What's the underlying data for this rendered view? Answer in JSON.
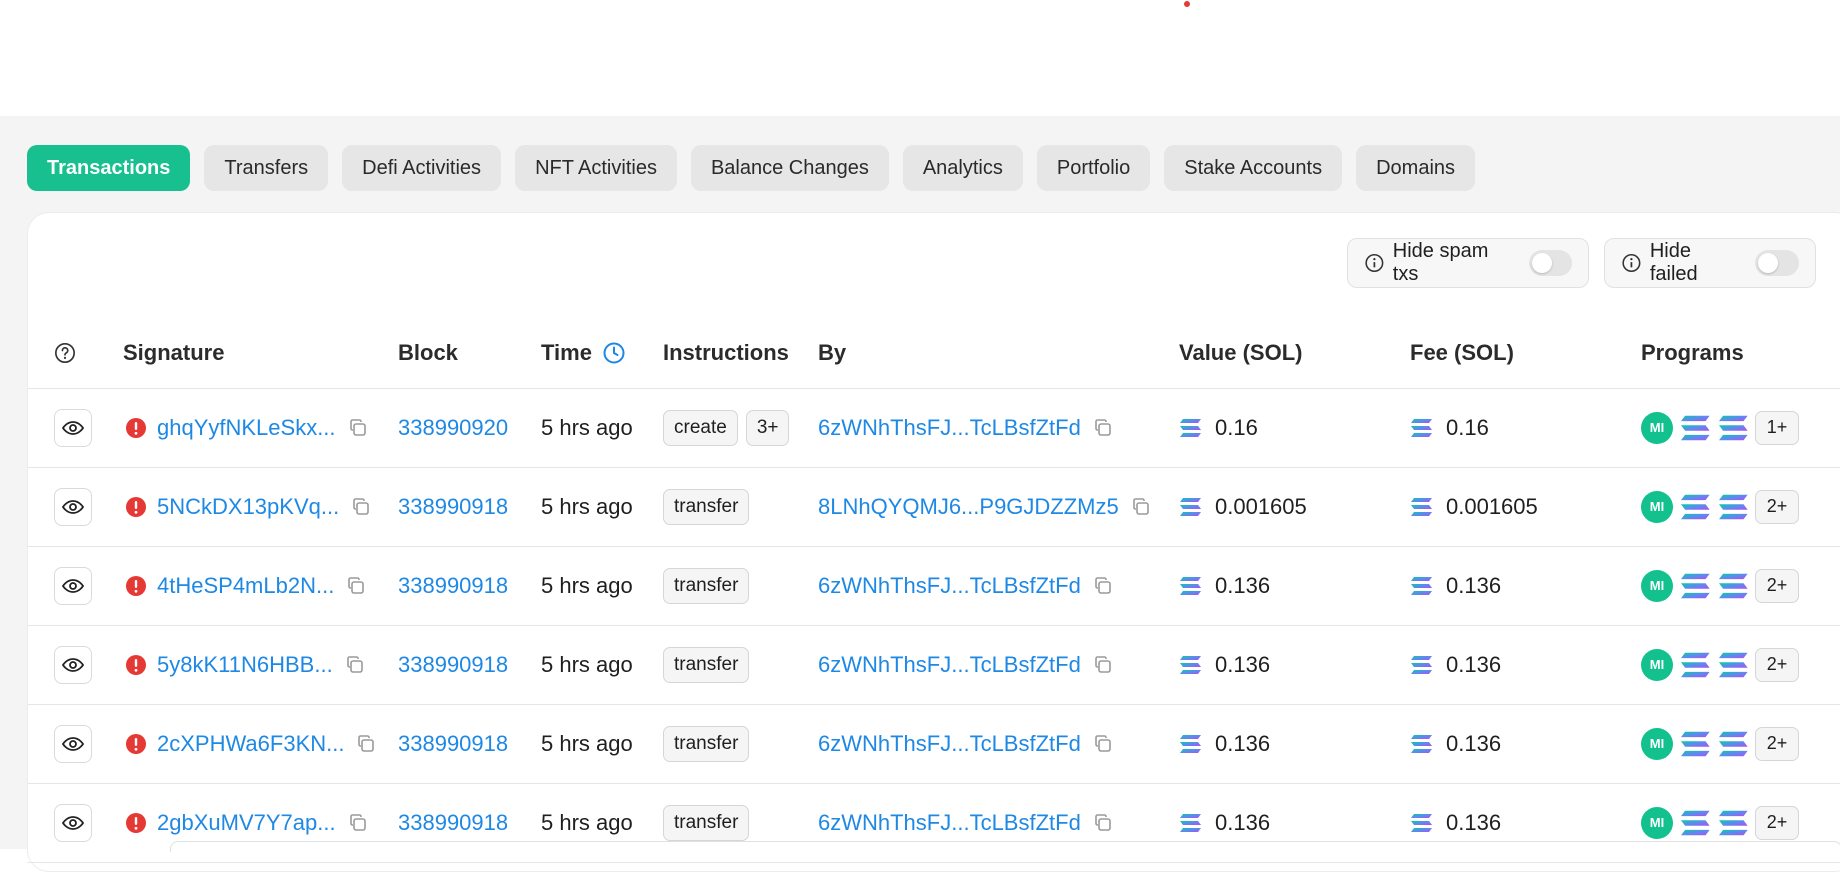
{
  "tabs": [
    "Transactions",
    "Transfers",
    "Defi Activities",
    "NFT Activities",
    "Balance Changes",
    "Analytics",
    "Portfolio",
    "Stake Accounts",
    "Domains"
  ],
  "filters": {
    "hide_spam": "Hide spam txs",
    "hide_failed": "Hide failed"
  },
  "headers": {
    "signature": "Signature",
    "block": "Block",
    "time": "Time",
    "instructions": "Instructions",
    "by": "By",
    "value": "Value (SOL)",
    "fee": "Fee (SOL)",
    "programs": "Programs"
  },
  "rows": [
    {
      "signature": "ghqYyfNKLeSkx...",
      "block": "338990920",
      "time": "5 hrs ago",
      "instruction": "create",
      "extra": "3+",
      "by": "6zWNhThsFJ...TcLBsfZtFd",
      "value": "0.16",
      "fee": "0.16",
      "program_badge": "MI",
      "more": "1+"
    },
    {
      "signature": "5NCkDX13pKVq...",
      "block": "338990918",
      "time": "5 hrs ago",
      "instruction": "transfer",
      "extra": "",
      "by": "8LNhQYQMJ6...P9GJDZZMz5",
      "value": "0.001605",
      "fee": "0.001605",
      "program_badge": "MI",
      "more": "2+"
    },
    {
      "signature": "4tHeSP4mLb2N...",
      "block": "338990918",
      "time": "5 hrs ago",
      "instruction": "transfer",
      "extra": "",
      "by": "6zWNhThsFJ...TcLBsfZtFd",
      "value": "0.136",
      "fee": "0.136",
      "program_badge": "MI",
      "more": "2+"
    },
    {
      "signature": "5y8kK11N6HBB...",
      "block": "338990918",
      "time": "5 hrs ago",
      "instruction": "transfer",
      "extra": "",
      "by": "6zWNhThsFJ...TcLBsfZtFd",
      "value": "0.136",
      "fee": "0.136",
      "program_badge": "MI",
      "more": "2+"
    },
    {
      "signature": "2cXPHWa6F3KN...",
      "block": "338990918",
      "time": "5 hrs ago",
      "instruction": "transfer",
      "extra": "",
      "by": "6zWNhThsFJ...TcLBsfZtFd",
      "value": "0.136",
      "fee": "0.136",
      "program_badge": "MI",
      "more": "2+"
    },
    {
      "signature": "2gbXuMV7Y7ap...",
      "block": "338990918",
      "time": "5 hrs ago",
      "instruction": "transfer",
      "extra": "",
      "by": "6zWNhThsFJ...TcLBsfZtFd",
      "value": "0.136",
      "fee": "0.136",
      "program_badge": "MI",
      "more": "2+"
    }
  ],
  "colors": {
    "accent": "#17c08e",
    "link": "#1e88e5",
    "error": "#e53935"
  }
}
